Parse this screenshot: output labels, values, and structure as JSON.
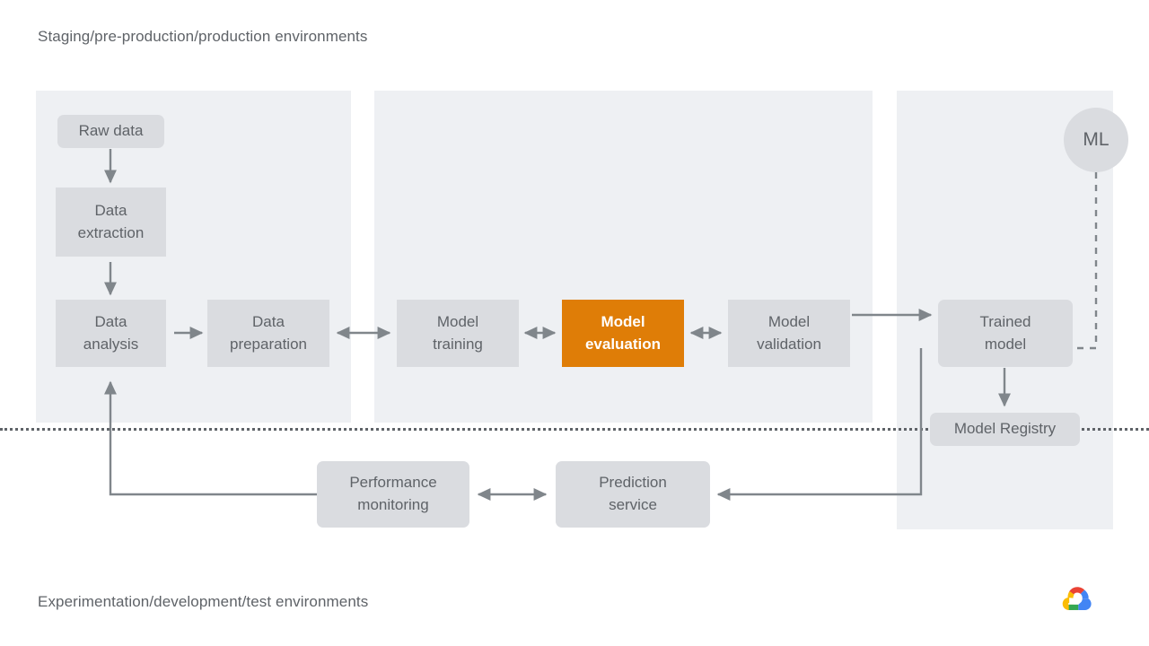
{
  "diagram": {
    "title_top": "Staging/pre-production/production environments",
    "title_bottom": "Experimentation/development/test environments",
    "brand_logo": "google-cloud-logo",
    "colors": {
      "panel_background": "#eef0f3",
      "node_background": "#dadce0",
      "node_text": "#5f6368",
      "accent": "#df7d07",
      "accent_text": "#ffffff",
      "connector": "#80868b",
      "divider": "#5f6368",
      "page_background": "#ffffff"
    },
    "panels": [
      {
        "name": "data-panel",
        "label": ""
      },
      {
        "name": "training-panel",
        "label": ""
      },
      {
        "name": "registry-panel",
        "label": ""
      }
    ],
    "nodes": [
      {
        "id": "raw-data",
        "label": "Raw data",
        "shape": "rounded",
        "emphasis": "normal"
      },
      {
        "id": "data-extraction",
        "label": "Data\nextraction",
        "shape": "rect",
        "emphasis": "normal"
      },
      {
        "id": "data-analysis",
        "label": "Data\nanalysis",
        "shape": "rect",
        "emphasis": "normal"
      },
      {
        "id": "data-preparation",
        "label": "Data\npreparation",
        "shape": "rect",
        "emphasis": "normal"
      },
      {
        "id": "model-training",
        "label": "Model\ntraining",
        "shape": "rect",
        "emphasis": "normal"
      },
      {
        "id": "model-evaluation",
        "label": "Model\nevaluation",
        "shape": "rect",
        "emphasis": "accent"
      },
      {
        "id": "model-validation",
        "label": "Model\nvalidation",
        "shape": "rect",
        "emphasis": "normal"
      },
      {
        "id": "trained-model",
        "label": "Trained\nmodel",
        "shape": "rounded",
        "emphasis": "normal"
      },
      {
        "id": "model-registry",
        "label": "Model Registry",
        "shape": "rounded",
        "emphasis": "normal"
      },
      {
        "id": "ml-metadata",
        "label": "ML",
        "shape": "circle",
        "emphasis": "normal"
      },
      {
        "id": "performance-monitoring",
        "label": "Performance\nmonitoring",
        "shape": "rounded",
        "emphasis": "normal"
      },
      {
        "id": "prediction-service",
        "label": "Prediction\nservice",
        "shape": "rounded",
        "emphasis": "normal"
      }
    ],
    "node_labels": {
      "raw_data": "Raw data",
      "data_extraction_line1": "Data",
      "data_extraction_line2": "extraction",
      "data_analysis_line1": "Data",
      "data_analysis_line2": "analysis",
      "data_preparation_line1": "Data",
      "data_preparation_line2": "preparation",
      "model_training_line1": "Model",
      "model_training_line2": "training",
      "model_evaluation_line1": "Model",
      "model_evaluation_line2": "evaluation",
      "model_validation_line1": "Model",
      "model_validation_line2": "validation",
      "trained_model_line1": "Trained",
      "trained_model_line2": "model",
      "model_registry": "Model Registry",
      "ml_metadata": "ML",
      "performance_monitoring_line1": "Performance",
      "performance_monitoring_line2": "monitoring",
      "prediction_service_line1": "Prediction",
      "prediction_service_line2": "service"
    },
    "connections": [
      {
        "from": "raw-data",
        "to": "data-extraction",
        "style": "solid",
        "direction": "forward"
      },
      {
        "from": "data-extraction",
        "to": "data-analysis",
        "style": "solid",
        "direction": "forward"
      },
      {
        "from": "data-analysis",
        "to": "data-preparation",
        "style": "solid",
        "direction": "forward"
      },
      {
        "from": "data-preparation",
        "to": "model-training",
        "style": "solid",
        "direction": "both"
      },
      {
        "from": "model-training",
        "to": "model-evaluation",
        "style": "solid",
        "direction": "both"
      },
      {
        "from": "model-evaluation",
        "to": "model-validation",
        "style": "solid",
        "direction": "both"
      },
      {
        "from": "model-validation",
        "to": "trained-model",
        "style": "solid",
        "direction": "forward"
      },
      {
        "from": "trained-model",
        "to": "model-registry",
        "style": "solid",
        "direction": "forward"
      },
      {
        "from": "ml-metadata",
        "to": "trained-model",
        "style": "dashed",
        "direction": "none"
      },
      {
        "from": "trained-model",
        "to": "prediction-service",
        "style": "solid",
        "direction": "forward"
      },
      {
        "from": "prediction-service",
        "to": "performance-monitoring",
        "style": "solid",
        "direction": "both"
      },
      {
        "from": "performance-monitoring",
        "to": "data-analysis",
        "style": "solid",
        "direction": "forward"
      }
    ]
  }
}
